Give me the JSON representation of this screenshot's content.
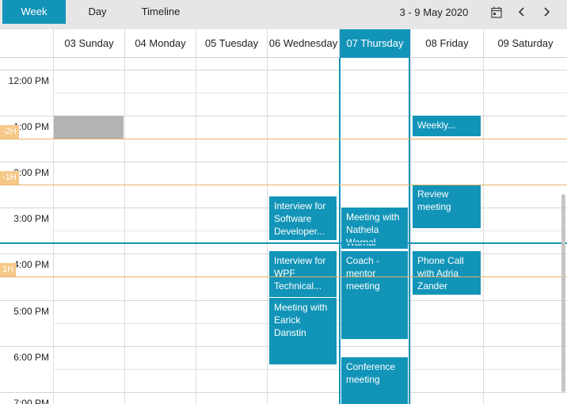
{
  "toolbar": {
    "views": [
      {
        "label": "Week",
        "active": true
      },
      {
        "label": "Day",
        "active": false
      },
      {
        "label": "Timeline",
        "active": false
      }
    ],
    "date_range": "3  - 9 May 2020",
    "icons": [
      "calendar-icon",
      "chevron-left-icon",
      "chevron-right-icon"
    ]
  },
  "days": [
    {
      "label": "03 Sunday"
    },
    {
      "label": "04 Monday"
    },
    {
      "label": "05 Tuesday"
    },
    {
      "label": "06 Wednesday"
    },
    {
      "label": "07 Thursday",
      "today": true
    },
    {
      "label": "08 Friday"
    },
    {
      "label": "09 Saturday"
    }
  ],
  "time_labels": [
    "12:00 PM",
    "1:00 PM",
    "2:00 PM",
    "3:00 PM",
    "4:00 PM",
    "5:00 PM",
    "6:00 PM",
    "7:00 PM"
  ],
  "appointments": [
    {
      "title": "Interview for Software Developer...",
      "day": 3,
      "start": 14.75,
      "end": 15.7
    },
    {
      "title": "Interview for WPF Technical...",
      "day": 3,
      "start": 15.95,
      "end": 16.95
    },
    {
      "title": "Meeting with Earick Danstin",
      "day": 3,
      "start": 16.95,
      "end": 18.4
    },
    {
      "title": "Meeting with Nathela Warnal",
      "day": 4,
      "start": 15.0,
      "end": 15.9
    },
    {
      "title": "Coach - mentor meeting",
      "day": 4,
      "start": 15.95,
      "end": 17.85
    },
    {
      "title": "Conference meeting",
      "day": 4,
      "start": 18.25,
      "end": 19.3
    },
    {
      "title": "Weekly...",
      "day": 5,
      "start": 13.0,
      "end": 13.45
    },
    {
      "title": "Review meeting",
      "day": 5,
      "start": 14.5,
      "end": 15.45
    },
    {
      "title": "Phone Call with Adria Zander",
      "day": 5,
      "start": 15.95,
      "end": 16.9
    }
  ],
  "blocked": [
    {
      "day": 0,
      "start": 13.0,
      "end": 13.5
    }
  ],
  "timezones": [
    {
      "label": "-2H",
      "time": 13.5
    },
    {
      "label": "-1H",
      "time": 14.5
    },
    {
      "label": "1H",
      "time": 16.5
    }
  ],
  "current_time": 15.75,
  "colors": {
    "accent": "#1294b8",
    "blocked": "#b3b3b3",
    "timezone_line": "#e8b06a",
    "timezone_tag": "#f6c887"
  }
}
